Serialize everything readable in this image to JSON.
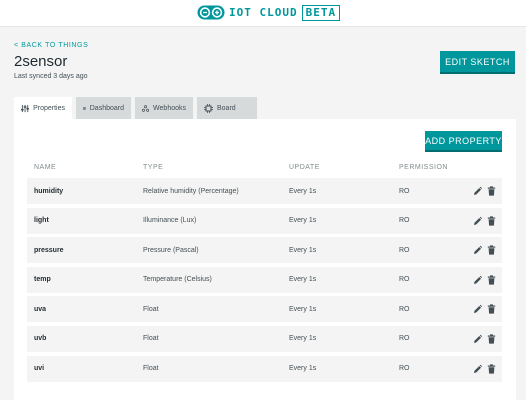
{
  "header": {
    "brand_text": "IOT CLOUD",
    "brand_badge": "BETA"
  },
  "page": {
    "back_link": "< BACK TO THINGS",
    "title": "2sensor",
    "last_synced": "Last synced 3 days ago",
    "edit_sketch_label": "EDIT SKETCH",
    "tabs": [
      {
        "label": "Properties",
        "icon": "sliders-icon",
        "active": true
      },
      {
        "label": "Dashboard",
        "icon": "dashboard-grid-icon",
        "active": false
      },
      {
        "label": "Webhooks",
        "icon": "webhooks-icon",
        "active": false
      },
      {
        "label": "Board",
        "icon": "chip-icon",
        "active": false
      }
    ],
    "add_property_label": "ADD PROPERTY",
    "columns": {
      "name": "NAME",
      "type": "TYPE",
      "update": "UPDATE",
      "permission": "PERMISSION"
    },
    "rows": [
      {
        "name": "humidity",
        "type": "Relative humidity (Percentage)",
        "update": "Every 1s",
        "permission": "RO"
      },
      {
        "name": "light",
        "type": "Illuminance (Lux)",
        "update": "Every 1s",
        "permission": "RO"
      },
      {
        "name": "pressure",
        "type": "Pressure (Pascal)",
        "update": "Every 1s",
        "permission": "RO"
      },
      {
        "name": "temp",
        "type": "Temperature (Celsius)",
        "update": "Every 1s",
        "permission": "RO"
      },
      {
        "name": "uva",
        "type": "Float",
        "update": "Every 1s",
        "permission": "RO"
      },
      {
        "name": "uvb",
        "type": "Float",
        "update": "Every 1s",
        "permission": "RO"
      },
      {
        "name": "uvi",
        "type": "Float",
        "update": "Every 1s",
        "permission": "RO"
      }
    ]
  },
  "colors": {
    "accent": "#00979c",
    "background": "#f4f4f4",
    "tab_inactive": "#d6dadb"
  }
}
